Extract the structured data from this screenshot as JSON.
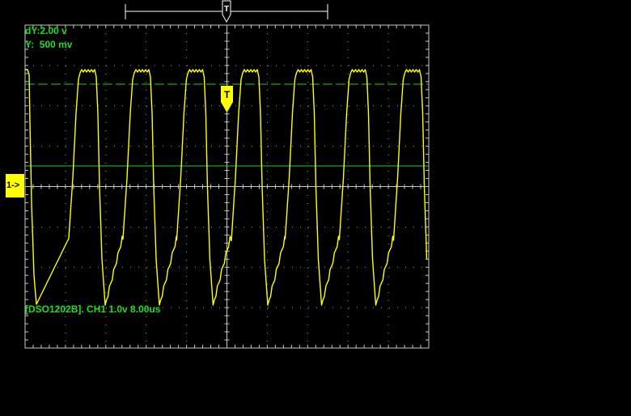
{
  "colors": {
    "background": "#000000",
    "graticule": "#9a9a9a",
    "frame": "#c8c8c8",
    "trace": "#ffff00",
    "cursor": "#22cc22",
    "readout_text": "#22dd22",
    "marker_bg": "#ffff00",
    "marker_text": "#000000",
    "trigger_bar": "#ffffff"
  },
  "readouts": {
    "dy": "dY:2.00 v",
    "y": "Y:  500 mv"
  },
  "status": {
    "text": "[DSO1202B]. CH1 1.0v 8.00us"
  },
  "channel_marker": {
    "label": "1->"
  },
  "trigger": {
    "label": "T",
    "top_marker_label": "T"
  },
  "icons": {
    "trigger_level": "trigger-level-icon",
    "trigger_position": "trigger-position-icon"
  }
}
